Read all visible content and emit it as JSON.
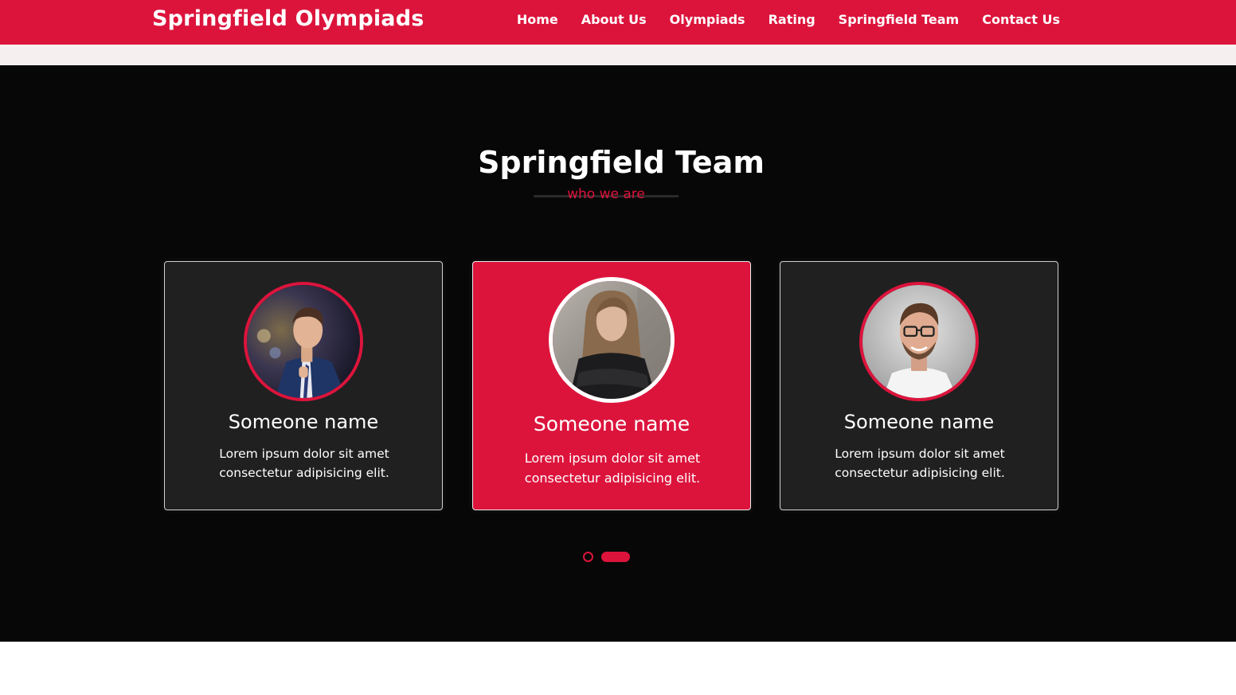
{
  "navbar": {
    "brand": "Springfield Olympiads",
    "links": [
      "Home",
      "About Us",
      "Olympiads",
      "Rating",
      "Springfield Team",
      "Contact Us"
    ]
  },
  "team": {
    "title": "Springfield Team",
    "subtitle": "who we are",
    "members": [
      {
        "name": "Someone name",
        "text": "Lorem ipsum dolor sit amet consectetur adipisicing elit."
      },
      {
        "name": "Someone name",
        "text": "Lorem ipsum dolor sit amet consectetur adipisicing elit."
      },
      {
        "name": "Someone name",
        "text": "Lorem ipsum dolor sit amet consectetur adipisicing elit."
      }
    ]
  },
  "colors": {
    "accent": "#dc143c",
    "section_bg": "#070707",
    "card_bg": "#202020"
  }
}
